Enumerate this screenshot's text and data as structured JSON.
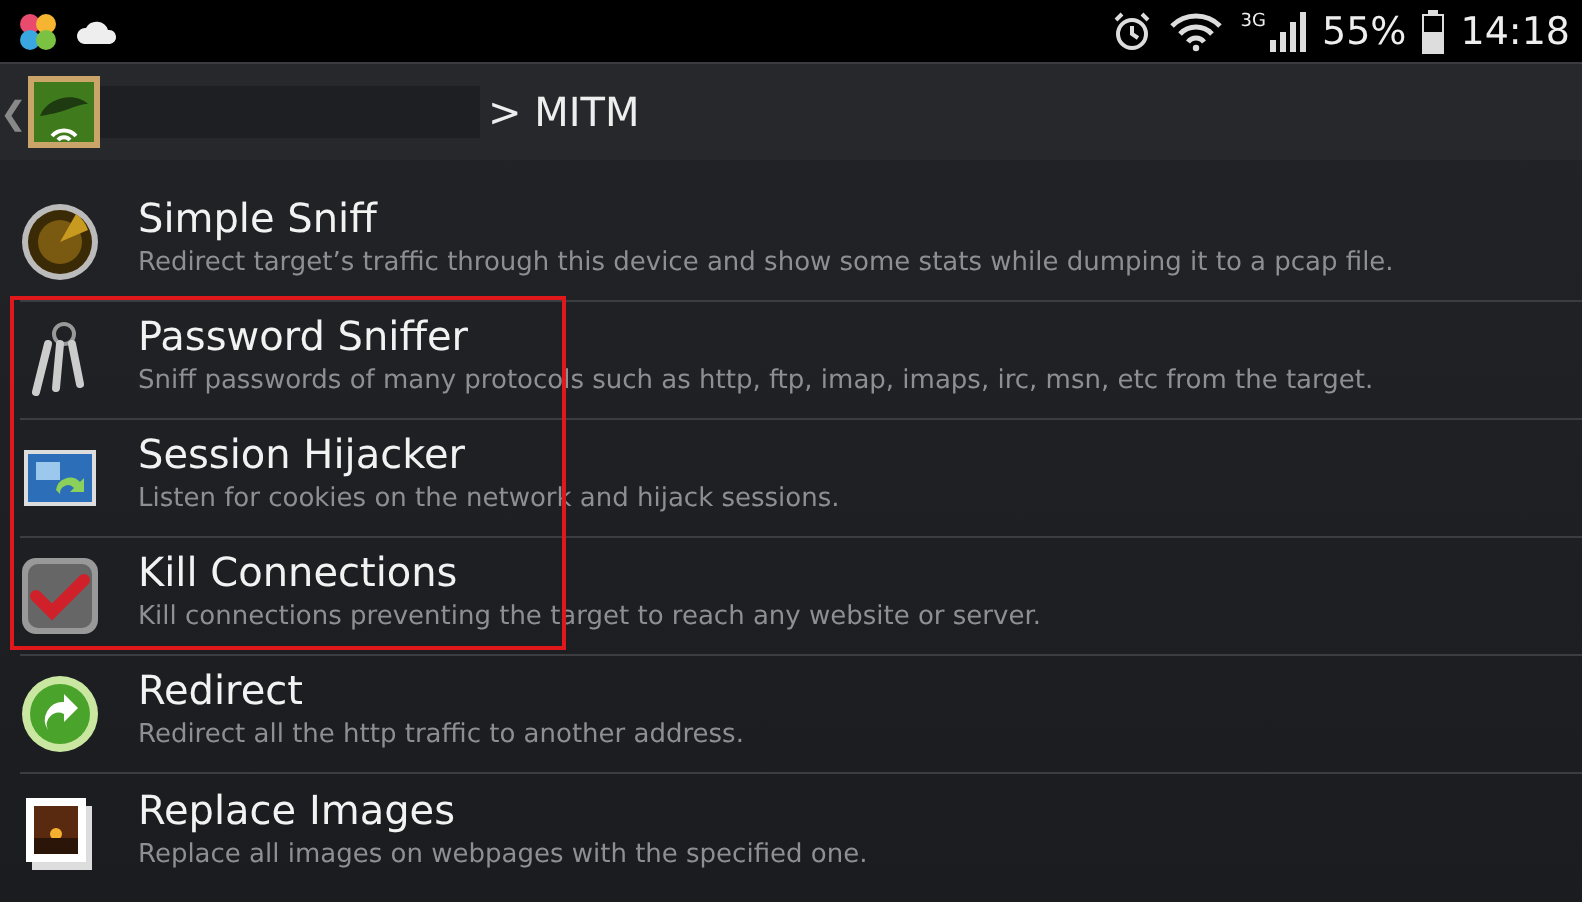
{
  "status_bar": {
    "network": "3G",
    "battery": "55%",
    "time": "14:18"
  },
  "action_bar": {
    "back": "❮",
    "title": "> MITM"
  },
  "items": [
    {
      "kind": "radar",
      "title": "Simple Sniff",
      "description": "Redirect target’s traffic through this device and show some stats while dumping it to a pcap file.",
      "highlighted": false
    },
    {
      "kind": "keys",
      "title": "Password Sniffer",
      "description": "Sniff passwords of many protocols such as http, ftp, imap, imaps, irc, msn, etc from the target.",
      "highlighted": true
    },
    {
      "kind": "session",
      "title": "Session Hijacker",
      "description": "Listen for cookies on the network and hijack sessions.",
      "highlighted": true
    },
    {
      "kind": "kill",
      "title": "Kill Connections",
      "description": "Kill connections preventing the target to reach any website or server.",
      "highlighted": true
    },
    {
      "kind": "redirect",
      "title": "Redirect",
      "description": "Redirect all the http traffic to another address.",
      "highlighted": false
    },
    {
      "kind": "image",
      "title": "Replace Images",
      "description": "Replace all images on webpages with the specified one.",
      "highlighted": false
    }
  ]
}
